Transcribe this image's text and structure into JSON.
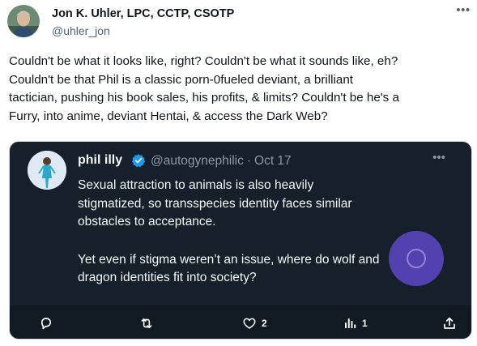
{
  "post": {
    "author_name": "Jon K. Uhler, LPC, CCTP, CSOTP",
    "author_handle": "@uhler_jon",
    "more_icon": "more-horizontal-icon",
    "text_lines": [
      "Couldn't be what it looks like, right? Couldn't be what it sounds like, eh?",
      "Couldn't be that Phil is a classic porn-0fueled deviant, a brilliant",
      "tactician, pushing his book sales, his profits, & limits? Couldn't be he's a",
      "Furry, into anime, deviant Hentai, & access the Dark Web?"
    ]
  },
  "quoted": {
    "name": "phil illy",
    "verified_icon": "verified-badge-icon",
    "handle": "@autogynephilic",
    "separator": "·",
    "date": "Oct 17",
    "more_icon": "more-horizontal-icon",
    "paragraph1_lines": [
      "Sexual attraction to animals is also heavily",
      "stigmatized, so transspecies identity faces similar",
      "obstacles to acceptance."
    ],
    "paragraph2_lines": [
      "Yet even if stigma weren’t an issue, where do wolf and",
      "dragon identities fit into society?"
    ]
  },
  "actions": {
    "reply": {
      "icon": "reply-icon",
      "count": ""
    },
    "retweet": {
      "icon": "retweet-icon",
      "count": ""
    },
    "like": {
      "icon": "heart-icon",
      "count": "2"
    },
    "views": {
      "icon": "views-chart-icon",
      "count": "1"
    },
    "share": {
      "icon": "share-icon",
      "count": ""
    }
  },
  "colors": {
    "embed_bg": "#15202b",
    "accent_blue": "#1d9bf0",
    "touch_indicator": "#7856ff"
  }
}
